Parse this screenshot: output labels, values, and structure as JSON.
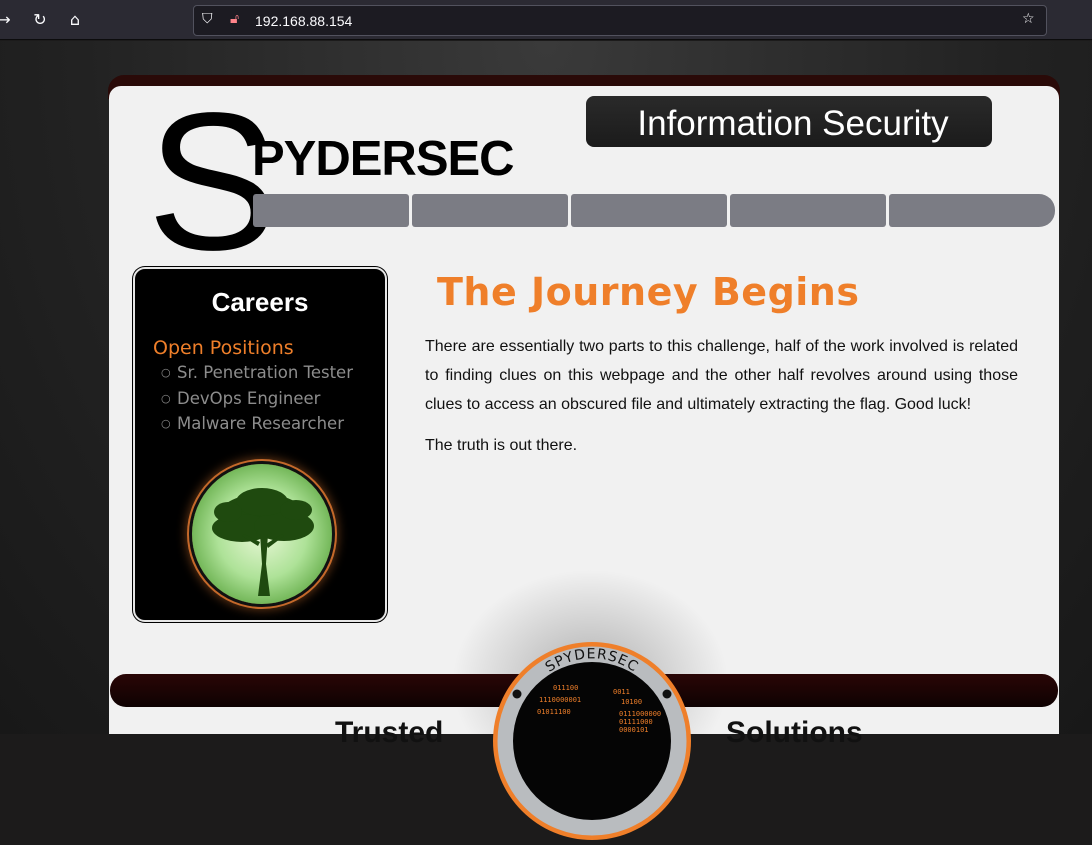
{
  "browser": {
    "url": "192.168.88.154",
    "icons": [
      "forward-icon",
      "reload-icon",
      "home-icon",
      "shield-icon",
      "insecure-lock-icon",
      "bookmark-star-icon"
    ]
  },
  "header": {
    "logo_initial": "S",
    "logo_rest": "PYDERSEC",
    "tagline": "Information Security",
    "nav_items": [
      "",
      "",
      "",
      "",
      ""
    ]
  },
  "sidebar": {
    "title": "Careers",
    "subtitle": "Open Positions",
    "positions": [
      "Sr. Penetration Tester",
      "DevOps Engineer",
      "Malware Researcher"
    ]
  },
  "main": {
    "headline": "The Journey Begins",
    "paragraph1": "There are essentially two parts to this challenge, half of the work involved is related to finding clues on this webpage and the other half revolves around using those clues to access an obscured file and ultimately extracting the flag. Good luck!",
    "paragraph2": "The truth is out there."
  },
  "footer": {
    "emblem_text": "SPYDERSEC",
    "left_word": "Trusted",
    "right_word": "Solutions",
    "emblem_binary": "0111000000011110000010101",
    "colors": {
      "accent": "#ef7f2a",
      "bar": "#1e0404"
    }
  }
}
